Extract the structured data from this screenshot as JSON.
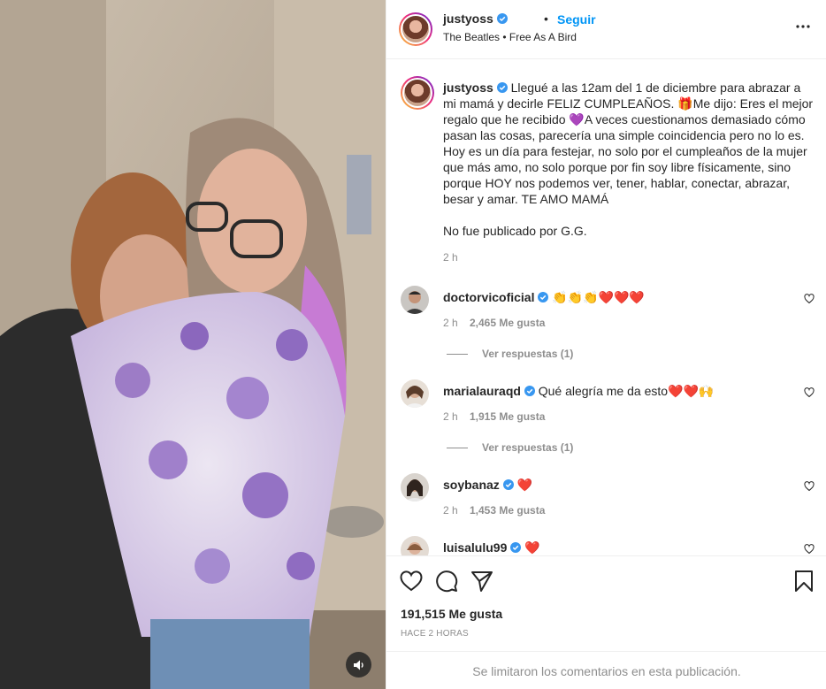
{
  "post_header": {
    "username": "justyoss",
    "separator": "•",
    "follow_label": "Seguir",
    "song": "The Beatles • Free As A Bird"
  },
  "caption": {
    "username": "justyoss",
    "text": "Llegué a las 12am del 1 de diciembre para abrazar a mi mamá y decirle FELIZ CUMPLEAÑOS. 🎁Me dijo: Eres el mejor regalo que he recibido 💜A veces cuestionamos demasiado cómo pasan las cosas, parecería una simple coincidencia pero no lo es. Hoy es un día para festejar, no solo por el cumpleaños de la mujer que más amo, no solo porque por fin soy libre físicamente, sino porque HOY nos podemos ver, tener, hablar, conectar, abrazar, besar y amar. TE AMO MAMÁ",
    "note": "No fue publicado por G.G.",
    "time": "2 h"
  },
  "comments": [
    {
      "username": "doctorvicoficial",
      "text": "👏👏👏❤️❤️❤️",
      "time": "2 h",
      "likes": "2,465 Me gusta",
      "replies": "Ver respuestas (1)"
    },
    {
      "username": "marialauraqd",
      "text": "Qué alegría me da esto❤️❤️🙌",
      "time": "2 h",
      "likes": "1,915 Me gusta",
      "replies": "Ver respuestas (1)"
    },
    {
      "username": "soybanaz",
      "text": "❤️",
      "time": "2 h",
      "likes": "1,453 Me gusta"
    },
    {
      "username": "luisalulu99",
      "text": "❤️"
    }
  ],
  "footer": {
    "likes": "191,515 Me gusta",
    "ago": "HACE 2 HORAS",
    "comments_limited": "Se limitaron los comentarios en esta publicación."
  },
  "icons": {
    "verified": "verified-badge-icon",
    "heart": "heart-icon",
    "comment": "comment-icon",
    "share": "share-icon",
    "save": "bookmark-icon",
    "more": "more-options-icon",
    "audio": "speaker-icon"
  },
  "colors": {
    "link": "#0095f6",
    "verified": "#3897f0",
    "muted": "#8e8e8e",
    "text": "#262626"
  }
}
